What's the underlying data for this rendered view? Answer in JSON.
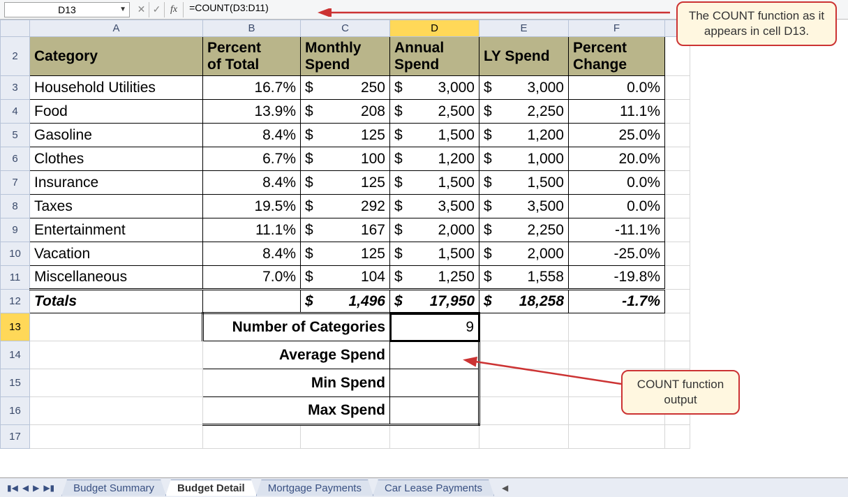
{
  "formula_bar": {
    "name_box": "D13",
    "fx_label": "fx",
    "formula": "=COUNT(D3:D11)"
  },
  "columns": [
    "A",
    "B",
    "C",
    "D",
    "E",
    "F"
  ],
  "selected_col": "D",
  "selected_row": "13",
  "col_widths": {
    "rowhdr": 42,
    "A": 248,
    "B": 140,
    "C": 128,
    "D": 128,
    "E": 128,
    "F": 138,
    "G": 36
  },
  "headers": {
    "A": "Category",
    "B": "Percent of Total",
    "C": "Monthly Spend",
    "D": "Annual Spend",
    "E": "LY Spend",
    "F": "Percent Change"
  },
  "rows": [
    {
      "r": 3,
      "cat": "Household Utilities",
      "pct": "16.7%",
      "mon": "250",
      "ann": "3,000",
      "ly": "3,000",
      "chg": "0.0%"
    },
    {
      "r": 4,
      "cat": "Food",
      "pct": "13.9%",
      "mon": "208",
      "ann": "2,500",
      "ly": "2,250",
      "chg": "11.1%"
    },
    {
      "r": 5,
      "cat": "Gasoline",
      "pct": "8.4%",
      "mon": "125",
      "ann": "1,500",
      "ly": "1,200",
      "chg": "25.0%"
    },
    {
      "r": 6,
      "cat": "Clothes",
      "pct": "6.7%",
      "mon": "100",
      "ann": "1,200",
      "ly": "1,000",
      "chg": "20.0%"
    },
    {
      "r": 7,
      "cat": "Insurance",
      "pct": "8.4%",
      "mon": "125",
      "ann": "1,500",
      "ly": "1,500",
      "chg": "0.0%"
    },
    {
      "r": 8,
      "cat": "Taxes",
      "pct": "19.5%",
      "mon": "292",
      "ann": "3,500",
      "ly": "3,500",
      "chg": "0.0%"
    },
    {
      "r": 9,
      "cat": "Entertainment",
      "pct": "11.1%",
      "mon": "167",
      "ann": "2,000",
      "ly": "2,250",
      "chg": "-11.1%"
    },
    {
      "r": 10,
      "cat": "Vacation",
      "pct": "8.4%",
      "mon": "125",
      "ann": "1,500",
      "ly": "2,000",
      "chg": "-25.0%"
    },
    {
      "r": 11,
      "cat": "Miscellaneous",
      "pct": "7.0%",
      "mon": "104",
      "ann": "1,250",
      "ly": "1,558",
      "chg": "-19.8%"
    }
  ],
  "totals": {
    "label": "Totals",
    "mon": "1,496",
    "ann": "17,950",
    "ly": "18,258",
    "chg": "-1.7%"
  },
  "summary": {
    "num_cat_label": "Number of Categories",
    "num_cat_val": "9",
    "avg_label": "Average Spend",
    "min_label": "Min Spend",
    "max_label": "Max Spend"
  },
  "callouts": {
    "top": "The COUNT function as it appears in cell D13.",
    "right": "COUNT function output"
  },
  "tabs": {
    "items": [
      "Budget Summary",
      "Budget Detail",
      "Mortgage Payments",
      "Car Lease Payments"
    ],
    "active": "Budget Detail"
  }
}
